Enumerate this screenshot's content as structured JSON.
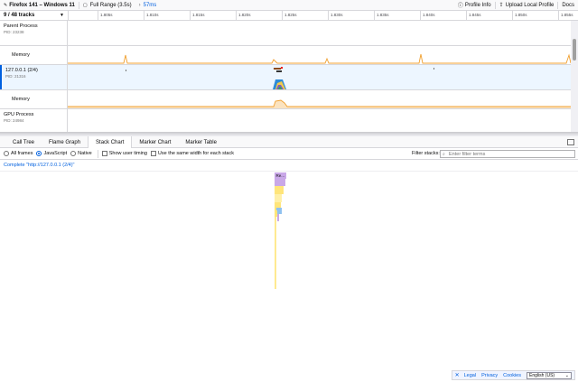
{
  "topbar": {
    "title": "Firefox 141 – Windows 11",
    "range_label": "Full Range (3.5s)",
    "zoom_label": "57ms",
    "profile_info": "Profile Info",
    "upload": "Upload Local Profile",
    "docs": "Docs"
  },
  "timeline": {
    "track_count": "9 / 48 tracks",
    "ticks": [
      "1.805s",
      "1.810s",
      "1.815s",
      "1.820s",
      "1.825s",
      "1.830s",
      "1.835s",
      "1.840s",
      "1.845s",
      "1.850s",
      "1.855s"
    ]
  },
  "tracks": {
    "parent": {
      "name": "Parent Process",
      "pid": "PID: 23238"
    },
    "parent_memory": {
      "name": "Memory"
    },
    "content": {
      "name": "127.0.0.1 (2/4)",
      "pid": "PID: 21316"
    },
    "content_memory": {
      "name": "Memory"
    },
    "gpu": {
      "name": "GPU Process",
      "pid": "PID: 24984"
    }
  },
  "tabs": [
    "Call Tree",
    "Flame Graph",
    "Stack Chart",
    "Marker Chart",
    "Marker Table"
  ],
  "active_tab": "Stack Chart",
  "settings": {
    "all_frames": "All frames",
    "javascript": "JavaScript",
    "native": "Native",
    "show_user_timing": "Show user timing",
    "same_width": "Use the same width for each stack",
    "filter_label": "Filter stacks:",
    "filter_placeholder": "Enter filter terms"
  },
  "breadcrumb": "Complete \"http://127.0.0.1 (2/4)\"",
  "stack_chart": {
    "top_frame_label": "Re..."
  },
  "footer": {
    "legal": "Legal",
    "privacy": "Privacy",
    "cookies": "Cookies",
    "language": "English (US)"
  },
  "colors": {
    "accent": "#0060df",
    "memory": "#f0a030",
    "js": "#ffe57a",
    "layout": "#c9a8e8",
    "graphics": "#8fc1f0"
  }
}
